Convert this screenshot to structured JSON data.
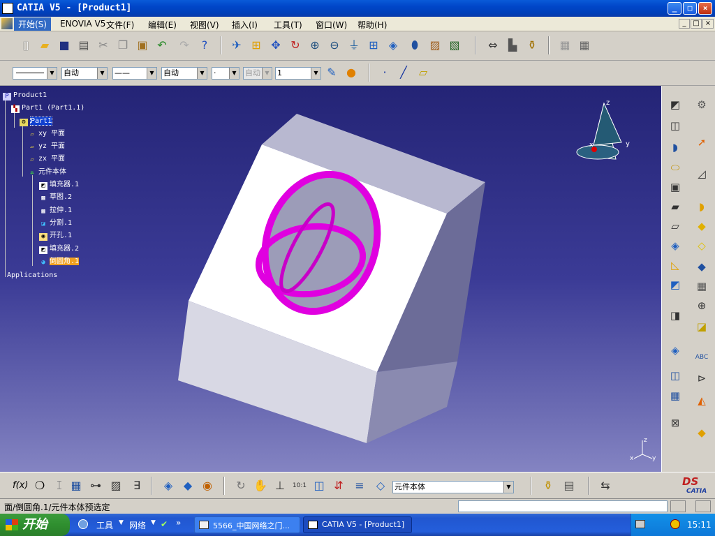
{
  "window": {
    "title": "CATIA V5 - [Product1]",
    "min": "_",
    "max": "□",
    "close": "×"
  },
  "menu": {
    "items": [
      "开始(S)",
      "ENOVIA V5",
      "文件(F)",
      "编辑(E)",
      "视图(V)",
      "插入(I)",
      "工具(T)",
      "窗口(W)",
      "帮助(H)"
    ],
    "mdi": [
      "_",
      "□",
      "×"
    ]
  },
  "toolbar2": {
    "color": "",
    "transparency": "自动",
    "linetype": "——",
    "linewidth": "自动",
    "point": "·",
    "layer": "自动",
    "layer_value": "1"
  },
  "tree": {
    "nodes": [
      {
        "label": "Product1",
        "icon": "product-icon"
      },
      {
        "label": "Part1 (Part1.1)",
        "icon": "part-instance-icon"
      },
      {
        "label": "Part1",
        "icon": "part-icon"
      },
      {
        "label": "xy 平面",
        "icon": "plane-icon"
      },
      {
        "label": "yz 平面",
        "icon": "plane-icon"
      },
      {
        "label": "zx 平面",
        "icon": "plane-icon"
      },
      {
        "label": "元件本体",
        "icon": "body-icon"
      },
      {
        "label": "填充器.1",
        "icon": "pad-icon"
      },
      {
        "label": "草图.2",
        "icon": "sketch-icon"
      },
      {
        "label": "拉伸.1",
        "icon": "extrude-icon"
      },
      {
        "label": "分割.1",
        "icon": "split-icon"
      },
      {
        "label": "开孔.1",
        "icon": "hole-icon"
      },
      {
        "label": "填充器.2",
        "icon": "pad-icon"
      },
      {
        "label": "倒圆角.1",
        "icon": "fillet-icon"
      },
      {
        "label": "Applications",
        "icon": "applications-icon"
      }
    ]
  },
  "compass": {
    "z": "z",
    "y": "y",
    "x": "x"
  },
  "axis_mini": {
    "z": "z",
    "x": "x",
    "y": "y"
  },
  "bottom_toolbar": {
    "body_select": "元件本体"
  },
  "brand": {
    "ds": "DS",
    "catia": "CATIA"
  },
  "status": {
    "text": "面/倒圆角.1/元件本体预选定"
  },
  "taskbar": {
    "start": "开始",
    "quick_tools": "工具",
    "quick_network": "网络",
    "more": "»",
    "tasks": [
      {
        "label": "5566_中国网络之门..."
      },
      {
        "label": "CATIA V5 - [Product1]"
      }
    ],
    "clock": "15:11"
  },
  "colors": {
    "fillet_highlight": "#e000e0",
    "part_face": "#ffffff",
    "viewport_top": "#242476"
  }
}
